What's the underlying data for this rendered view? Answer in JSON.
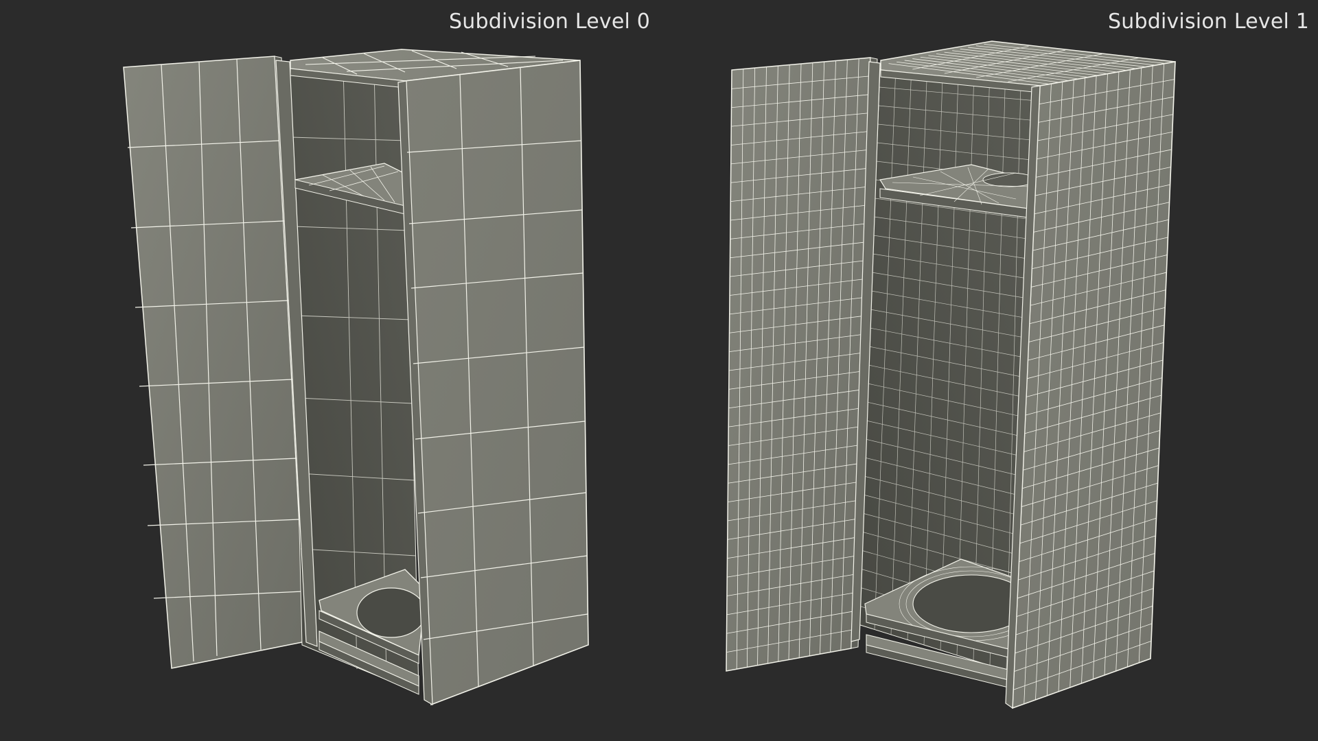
{
  "labels": {
    "left": "Subdivision Level 0",
    "right": "Subdivision Level 1"
  },
  "colors": {
    "background": "#2b2b2b",
    "surface": "#7a7b72",
    "surface_dark": "#4f504a",
    "wire": "#f3f3ea",
    "text": "#e6e6e6"
  },
  "models": [
    {
      "name": "cabinet-subdivision-level-0",
      "subdivision_level": 0
    },
    {
      "name": "cabinet-subdivision-level-1",
      "subdivision_level": 1
    }
  ]
}
